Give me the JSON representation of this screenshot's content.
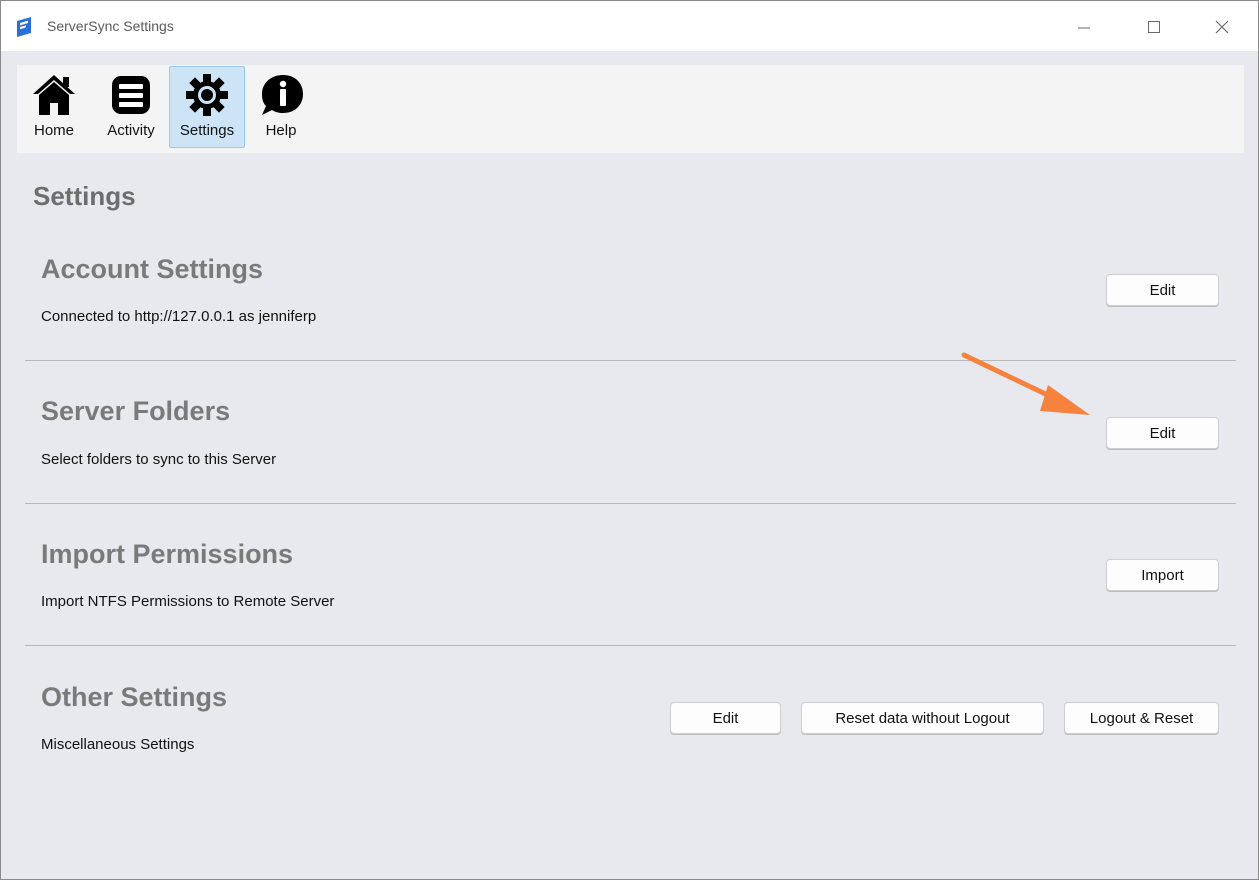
{
  "window": {
    "title": "ServerSync Settings",
    "controls": [
      "minimize",
      "maximize",
      "close"
    ]
  },
  "toolbar": {
    "items": [
      {
        "label": "Home",
        "icon": "home-icon",
        "active": false
      },
      {
        "label": "Activity",
        "icon": "list-icon",
        "active": false
      },
      {
        "label": "Settings",
        "icon": "gear-icon",
        "active": true
      },
      {
        "label": "Help",
        "icon": "info-bubble-icon",
        "active": false
      }
    ]
  },
  "page": {
    "title": "Settings"
  },
  "sections": {
    "account": {
      "title": "Account Settings",
      "description": "Connected to http://127.0.0.1 as jenniferp",
      "button": "Edit"
    },
    "server_folders": {
      "title": "Server Folders",
      "description": "Select folders to sync to this Server",
      "button": "Edit"
    },
    "import_permissions": {
      "title": "Import Permissions",
      "description": "Import NTFS Permissions to Remote Server",
      "button": "Import"
    },
    "other": {
      "title": "Other Settings",
      "description": "Miscellaneous Settings",
      "buttons": [
        "Edit",
        "Reset data without Logout",
        "Logout & Reset"
      ]
    }
  },
  "annotation": {
    "arrow_color": "#f5823d"
  }
}
